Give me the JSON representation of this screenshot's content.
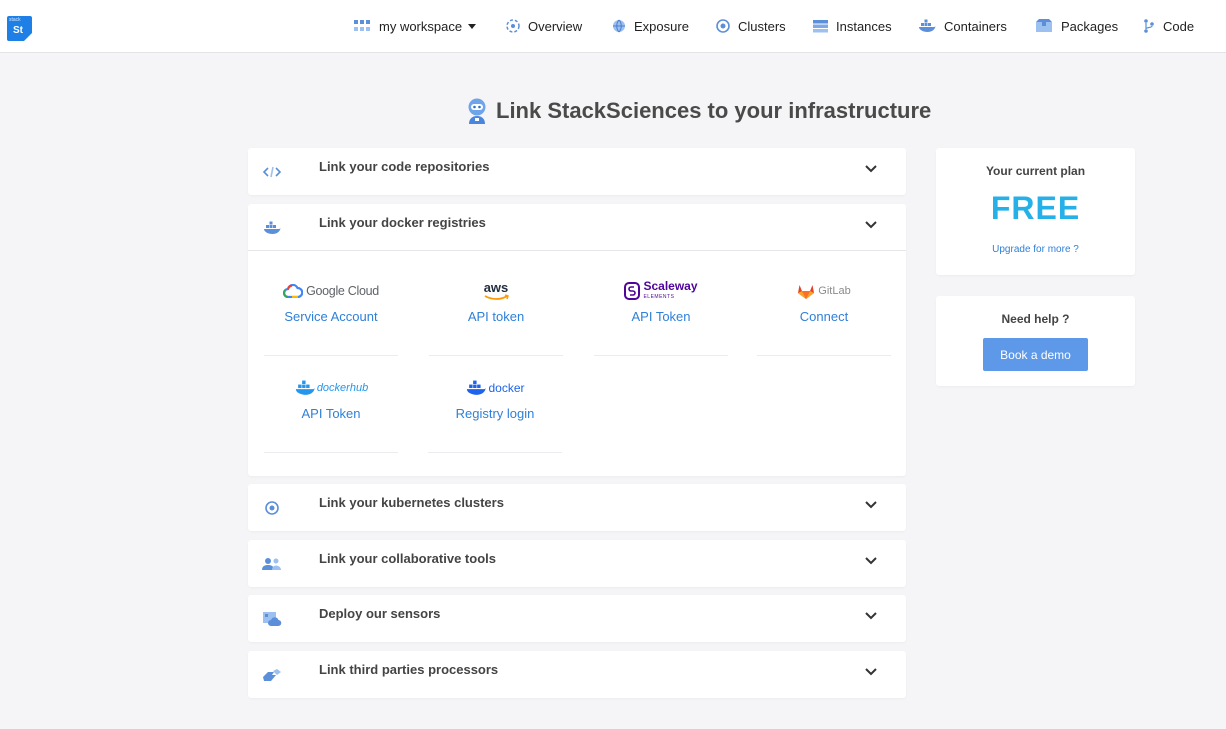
{
  "app": {
    "logo_small": "stack",
    "logo_text": "St"
  },
  "nav": {
    "workspace": "my workspace",
    "overview": "Overview",
    "exposure": "Exposure",
    "clusters": "Clusters",
    "instances": "Instances",
    "containers": "Containers",
    "packages": "Packages",
    "code": "Code"
  },
  "page": {
    "title": "Link StackSciences to your infrastructure"
  },
  "sections": {
    "code_repos": "Link your code repositories",
    "docker_registries": "Link your docker registries",
    "kubernetes": "Link your kubernetes clusters",
    "collaborative": "Link your collaborative tools",
    "sensors": "Deploy our sensors",
    "third_parties": "Link third parties processors"
  },
  "providers": [
    {
      "logo": "Google Cloud",
      "action": "Service Account"
    },
    {
      "logo": "aws",
      "action": "API token"
    },
    {
      "logo": "Scaleway",
      "logo_sub": "ELEMENTS",
      "action": "API Token"
    },
    {
      "logo": "GitLab",
      "action": "Connect"
    },
    {
      "logo": "dockerhub",
      "action": "API Token"
    },
    {
      "logo": "docker",
      "action": "Registry login"
    }
  ],
  "plan": {
    "title": "Your current plan",
    "name": "FREE",
    "upgrade": "Upgrade for more ?"
  },
  "help": {
    "title": "Need help ?",
    "button": "Book a demo"
  },
  "colors": {
    "accent": "#2f80d8",
    "free": "#25b1e8",
    "button": "#5e98e8",
    "logo_bg": "#1e80e6"
  },
  "icons": [
    "workspace-icon",
    "overview-icon",
    "globe-icon",
    "cluster-icon",
    "instances-icon",
    "docker-icon",
    "packages-icon",
    "code-branch-icon",
    "robot-icon",
    "code-icon",
    "kubernetes-icon",
    "users-icon",
    "sensor-icon",
    "processor-icon",
    "chevron-down-icon"
  ]
}
